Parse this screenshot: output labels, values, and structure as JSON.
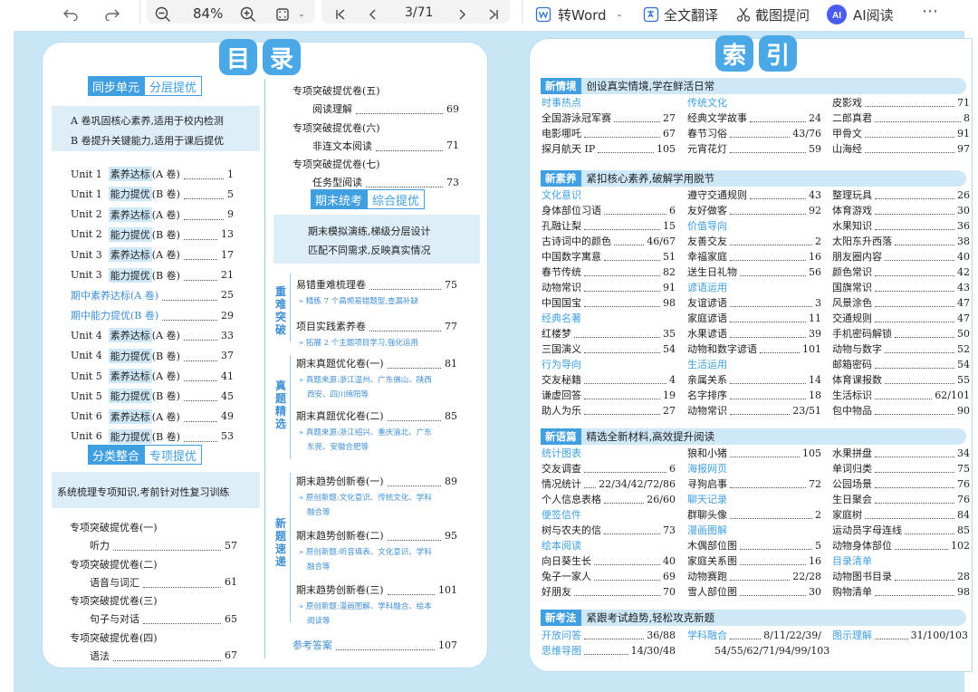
{
  "toolbar": {
    "zoom": "84%",
    "page_indicator": "3/71",
    "to_word": "转Word",
    "translate": "全文翻译",
    "screenshot_ask": "截图提问",
    "ai_read": "AI阅读"
  },
  "toc": {
    "title_chars": [
      "目",
      "录"
    ],
    "sync_tag": [
      "同步单元",
      "分层提优"
    ],
    "sync_desc": [
      "A 卷巩固核心素养,适用于校内检测",
      "B 卷提升关键能力,适用于课后提优"
    ],
    "units": [
      [
        "Unit 1",
        "素养达标",
        "(A 卷)",
        "1"
      ],
      [
        "Unit 1",
        "能力提优",
        "(B 卷)",
        "5"
      ],
      [
        "Unit 2",
        "素养达标",
        "(A 卷)",
        "9"
      ],
      [
        "Unit 2",
        "能力提优",
        "(B 卷)",
        "13"
      ],
      [
        "Unit 3",
        "素养达标",
        "(A 卷)",
        "17"
      ],
      [
        "Unit 3",
        "能力提优",
        "(B 卷)",
        "21"
      ],
      [
        "",
        "期中素养达标",
        "(A 卷)",
        "25"
      ],
      [
        "",
        "期中能力提优",
        "(B 卷)",
        "29"
      ],
      [
        "Unit 4",
        "素养达标",
        "(A 卷)",
        "33"
      ],
      [
        "Unit 4",
        "能力提优",
        "(B 卷)",
        "37"
      ],
      [
        "Unit 5",
        "素养达标",
        "(A 卷)",
        "41"
      ],
      [
        "Unit 5",
        "能力提优",
        "(B 卷)",
        "45"
      ],
      [
        "Unit 6",
        "素养达标",
        "(A 卷)",
        "49"
      ],
      [
        "Unit 6",
        "能力提优",
        "(B 卷)",
        "53"
      ]
    ],
    "classify_tag": [
      "分类整合",
      "专项提优"
    ],
    "classify_desc": "系统梳理专项知识,考前针对性复习训练",
    "special": [
      [
        "专项突破提优卷(一)",
        "听力",
        "57"
      ],
      [
        "专项突破提优卷(二)",
        "语音与词汇",
        "61"
      ],
      [
        "专项突破提优卷(三)",
        "句子与对话",
        "65"
      ],
      [
        "专项突破提优卷(四)",
        "语法",
        "67"
      ],
      [
        "专项突破提优卷(五)",
        "阅读理解",
        "69"
      ],
      [
        "专项突破提优卷(六)",
        "非连文本阅读",
        "71"
      ],
      [
        "专项突破提优卷(七)",
        "任务型阅读",
        "73"
      ]
    ],
    "final_tag": [
      "期末统考",
      "综合提优"
    ],
    "final_desc": [
      "期末模拟演练,梯级分层设计",
      "匹配不同需求,反映真实情况"
    ],
    "group1_label": "重难突破",
    "group1": [
      [
        "易错重难梳理卷",
        "75",
        "» 精练 7 个高频易错题型,查漏补缺"
      ],
      [
        "项目实践素养卷",
        "77",
        "» 拓展 2 个主题项目学习,强化运用"
      ]
    ],
    "group2_label": "真题精选",
    "group2": [
      [
        "期末真题优化卷(一)",
        "81",
        "» 真题来源:浙江温州、广东佛山、陕西",
        "西安、四川绵阳等"
      ],
      [
        "期末真题优化卷(二)",
        "85",
        "» 真题来源:浙江绍兴、重庆渝北、广东",
        "东莞、安徽合肥等"
      ]
    ],
    "group3_label": "新题速递",
    "group3": [
      [
        "期末趋势创新卷(一)",
        "89",
        "» 原创新题:文化意识、传统文化、学科",
        "融合等"
      ],
      [
        "期末趋势创新卷(二)",
        "95",
        "» 原创新题:听音填表、文化意识、学科",
        "融合等"
      ],
      [
        "期末趋势创新卷(三)",
        "101",
        "» 原创新题:漫画图解、学科融合、绘本",
        "阅读等"
      ]
    ],
    "answers": [
      "参考答案",
      "107"
    ]
  },
  "index": {
    "title_chars": [
      "索",
      "引"
    ],
    "sections": [
      {
        "key": "新情境",
        "text": "创设真实情境,学在鲜活日常"
      },
      {
        "key": "新素养",
        "text": "紧扣核心素养,破解学用脱节"
      },
      {
        "key": "新语篇",
        "text": "精选全新材料,高效提升阅读"
      },
      {
        "key": "新考法",
        "text": "紧跟考试趋势,轻松攻克新题"
      }
    ],
    "cats": [
      "时事热点",
      "传统文化",
      "文化意识",
      "价值导向",
      "谚语运用",
      "经典名著",
      "生活运用",
      "行为导向",
      "统计图表",
      "海报网页",
      "聊天记录",
      "便签信件",
      "漫画图解",
      "绘本阅读",
      "目录清单",
      "开放问答",
      "学科融合",
      "图示理解",
      "思维导图"
    ],
    "items": [
      [
        "全国游泳冠军赛",
        "27"
      ],
      [
        "电影哪吒",
        "67"
      ],
      [
        "探月航天 IP",
        "105"
      ],
      [
        "经典文学故事",
        "24"
      ],
      [
        "春节习俗",
        "43/76"
      ],
      [
        "元宵花灯",
        "59"
      ],
      [
        "皮影戏",
        "71"
      ],
      [
        "二郎真君",
        "8"
      ],
      [
        "甲骨文",
        "91"
      ],
      [
        "山海经",
        "97"
      ],
      [
        "身体部位习语",
        "6"
      ],
      [
        "孔融让梨",
        "15"
      ],
      [
        "古诗词中的颜色",
        "46/67"
      ],
      [
        "中国数字寓意",
        "51"
      ],
      [
        "春节传统",
        "82"
      ],
      [
        "动物常识",
        "91"
      ],
      [
        "中国国宝",
        "98"
      ],
      [
        "红楼梦",
        "35"
      ],
      [
        "三国演义",
        "54"
      ],
      [
        "交友秘籍",
        "4"
      ],
      [
        "谦虚回答",
        "19"
      ],
      [
        "助人为乐",
        "27"
      ],
      [
        "遵守交通规则",
        "43"
      ],
      [
        "友好做客",
        "92"
      ],
      [
        "友善交友",
        "2"
      ],
      [
        "幸福家庭",
        "16"
      ],
      [
        "送生日礼物",
        "56"
      ],
      [
        "友谊谚语",
        "3"
      ],
      [
        "家庭谚语",
        "11"
      ],
      [
        "水果谚语",
        "39"
      ],
      [
        "动物和数字谚语",
        "101"
      ],
      [
        "亲属关系",
        "14"
      ],
      [
        "名字排序",
        "18"
      ],
      [
        "动物常识",
        "23/51"
      ],
      [
        "整理玩具",
        "26"
      ],
      [
        "体育游戏",
        "30"
      ],
      [
        "水果知识",
        "36"
      ],
      [
        "太阳东升西落",
        "38"
      ],
      [
        "朋友圈内容",
        "40"
      ],
      [
        "颜色常识",
        "42"
      ],
      [
        "国旗常识",
        "43"
      ],
      [
        "风景涂色",
        "47"
      ],
      [
        "交通规则",
        "47"
      ],
      [
        "手机密码解锁",
        "50"
      ],
      [
        "动物与数字",
        "52"
      ],
      [
        "邮箱密码",
        "54"
      ],
      [
        "体育课报数",
        "55"
      ],
      [
        "生活标识",
        "62/101"
      ],
      [
        "包中物品",
        "90"
      ],
      [
        "交友调查",
        "6"
      ],
      [
        "情况统计",
        "22/34/42/72/86"
      ],
      [
        "个人信息表格",
        "26/60"
      ],
      [
        "树与农夫的信",
        "73"
      ],
      [
        "向日葵生长",
        "40"
      ],
      [
        "兔子一家人",
        "69"
      ],
      [
        "好朋友",
        "70"
      ],
      [
        "狼和小猪",
        "105"
      ],
      [
        "寻狗启事",
        "72"
      ],
      [
        "群聊头像",
        "2"
      ],
      [
        "木偶部位图",
        "5"
      ],
      [
        "家庭关系图",
        "16"
      ],
      [
        "动物赛跑",
        "22/28"
      ],
      [
        "雪人部位图",
        "30"
      ],
      [
        "水果拼盘",
        "34"
      ],
      [
        "单词归类",
        "75"
      ],
      [
        "公园场景",
        "76"
      ],
      [
        "生日聚会",
        "76"
      ],
      [
        "家庭树",
        "84"
      ],
      [
        "运动员字母连线",
        "85"
      ],
      [
        "动物身体部位",
        "102"
      ],
      [
        "动物图书目录",
        "28"
      ],
      [
        "购物清单",
        "98"
      ],
      [
        "36/88",
        "14/30/48",
        "8/11/22/39/",
        "54/55/62/71/94/99/103",
        "31/100/103"
      ]
    ]
  }
}
